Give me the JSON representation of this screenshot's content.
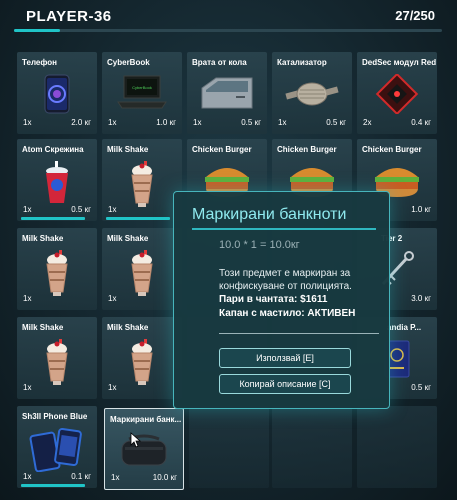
{
  "header": {
    "player": "PLAYER-36",
    "capacity": "27/250",
    "capacity_fraction": 0.108
  },
  "items": [
    {
      "label": "Телефон",
      "qty": "1x",
      "weight": "2.0 кг",
      "icon": "phone-icon"
    },
    {
      "label": "CyberBook",
      "qty": "1x",
      "weight": "1.0 кг",
      "icon": "laptop-icon"
    },
    {
      "label": "Врата от кола",
      "qty": "1x",
      "weight": "0.5 кг",
      "icon": "car-door-icon"
    },
    {
      "label": "Катализатор",
      "qty": "1x",
      "weight": "0.5 кг",
      "icon": "catalytic-converter-icon"
    },
    {
      "label": "DedSec модул Red",
      "qty": "2x",
      "weight": "0.4 кг",
      "icon": "chip-module-icon"
    },
    {
      "label": "Atom Скрежина",
      "qty": "1x",
      "weight": "0.5 кг",
      "icon": "slush-cup-icon"
    },
    {
      "label": "Milk Shake",
      "qty": "1x",
      "weight": "",
      "icon": "milkshake-icon"
    },
    {
      "label": "Chicken Burger",
      "qty": "",
      "weight": "",
      "icon": "burger-icon"
    },
    {
      "label": "Chicken Burger",
      "qty": "",
      "weight": "",
      "icon": "burger-icon"
    },
    {
      "label": "Chicken Burger",
      "qty": "",
      "weight": "1.0 кг",
      "icon": "burger-icon"
    },
    {
      "label": "Milk Shake",
      "qty": "1x",
      "weight": "",
      "icon": "milkshake-icon"
    },
    {
      "label": "Milk Shake",
      "qty": "1x",
      "weight": "",
      "icon": "milkshake-icon"
    },
    {
      "label": "Tier 2",
      "qty": "",
      "weight": "3.0 кг",
      "icon": "lockpick-icon"
    },
    {
      "label": "Milk Shake",
      "qty": "1x",
      "weight": "",
      "icon": "milkshake-icon"
    },
    {
      "label": "Milk Shake",
      "qty": "1x",
      "weight": "",
      "icon": "milkshake-icon"
    },
    {
      "label": "andia P...",
      "qty": "",
      "weight": "0.5 кг",
      "icon": "passport-icon"
    },
    {
      "label": "Sh3ll Phone Blue",
      "qty": "1x",
      "weight": "0.1 кг",
      "icon": "sh3ll-phone-icon"
    },
    {
      "label": "Маркирани банк...",
      "qty": "1x",
      "weight": "10.0 кг",
      "icon": "money-bag-icon"
    }
  ],
  "tooltip": {
    "title": "Маркирани банкноти",
    "formula": "10.0 * 1 = 10.0кг",
    "description": "Този предмет е маркиран за конфискуване от полицията.",
    "money": "Пари в чантата: $1611",
    "trap": "Капан с мастило: АКТИВЕН",
    "use_button": "Използвай [E]",
    "copy_button": "Копирай описание [C]"
  },
  "colors": {
    "accent": "#20c4c7",
    "tooltip_title": "#8fe9ee",
    "tooltip_border": "#47b5bc"
  }
}
